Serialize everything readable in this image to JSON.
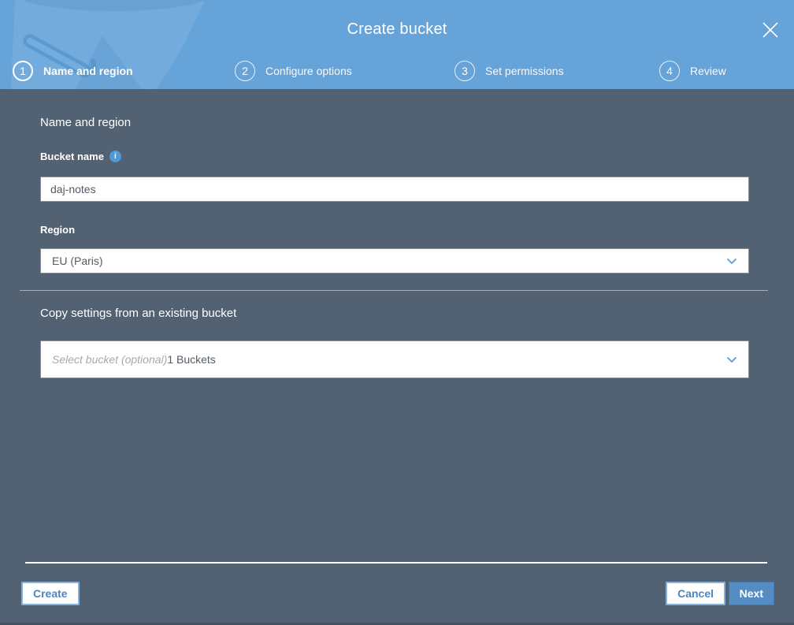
{
  "modal": {
    "title": "Create bucket"
  },
  "steps": [
    {
      "number": "1",
      "label": "Name and region",
      "active": true
    },
    {
      "number": "2",
      "label": "Configure options",
      "active": false
    },
    {
      "number": "3",
      "label": "Set permissions",
      "active": false
    },
    {
      "number": "4",
      "label": "Review",
      "active": false
    }
  ],
  "form": {
    "section_title": "Name and region",
    "bucket_name_label": "Bucket name",
    "info_icon_glyph": "i",
    "bucket_name_value": "daj-notes",
    "region_label": "Region",
    "region_value": "EU (Paris)",
    "copy_section_title": "Copy settings from an existing bucket",
    "bucket_select_placeholder": "Select bucket (optional)",
    "bucket_select_suffix": "1 Buckets"
  },
  "footer": {
    "create_label": "Create",
    "cancel_label": "Cancel",
    "next_label": "Next"
  },
  "colors": {
    "header_blue": "#65a3d9",
    "body_slate": "#526272",
    "accent_blue": "#4a86c0",
    "primary_button_blue": "#548cc4"
  }
}
